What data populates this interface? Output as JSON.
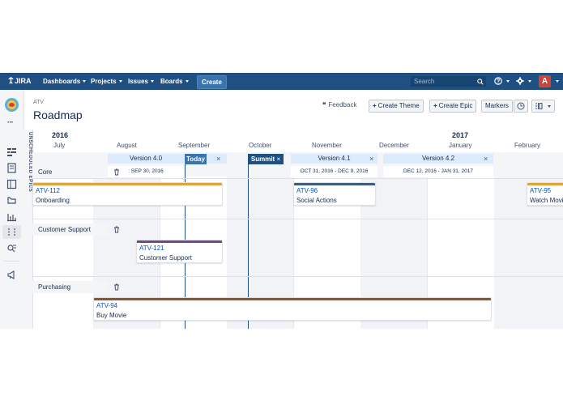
{
  "nav": {
    "logo": "JIRA",
    "items": [
      "Dashboards",
      "Projects",
      "Issues",
      "Boards"
    ],
    "create": "Create",
    "search_placeholder": "Search",
    "avatar_letter": "A"
  },
  "header": {
    "project_key": "ATV",
    "title": "Roadmap",
    "feedback": "Feedback",
    "buttons": [
      "Create Theme",
      "Create Epic",
      "Markers"
    ]
  },
  "sidebar": {
    "unscheduled_label": "UNSCHEDULED EPICS"
  },
  "timeline": {
    "years": [
      "2016",
      "2017"
    ],
    "months": [
      "July",
      "August",
      "September",
      "October",
      "November",
      "December",
      "January",
      "February"
    ],
    "versions": [
      {
        "name": "Version 4.0",
        "dates": ": SEP 30, 2016"
      },
      {
        "name": "Version 4.1",
        "dates": "OCT 31, 2016 - DEC 9, 2016"
      },
      {
        "name": "Version 4.2",
        "dates": "DEC 12, 2016 - JAN 31, 2017"
      }
    ],
    "markers": [
      "Today",
      "Summit"
    ],
    "themes": [
      {
        "name": "Core",
        "color": "#e2a33a"
      },
      {
        "name": "Customer Support",
        "color": "#6e4a8c"
      },
      {
        "name": "Purchasing",
        "color": "#7a5a44"
      }
    ],
    "epics": [
      {
        "key": "ATV-112",
        "title": "Onboarding",
        "color": "#e2a33a"
      },
      {
        "key": "ATV-96",
        "title": "Social Actions",
        "color": "#3d5c7e"
      },
      {
        "key": "ATV-95",
        "title": "Watch Movie",
        "color": "#e2a33a"
      },
      {
        "key": "ATV-121",
        "title": "Customer Support",
        "color": "#6e4a8c"
      },
      {
        "key": "ATV-94",
        "title": "Buy Movie",
        "color": "#7a5a44"
      }
    ]
  },
  "colors": {
    "nav_bg": "#205081",
    "marker_bg": "#205081",
    "version_bg": "#deebff",
    "link": "#0052cc"
  }
}
